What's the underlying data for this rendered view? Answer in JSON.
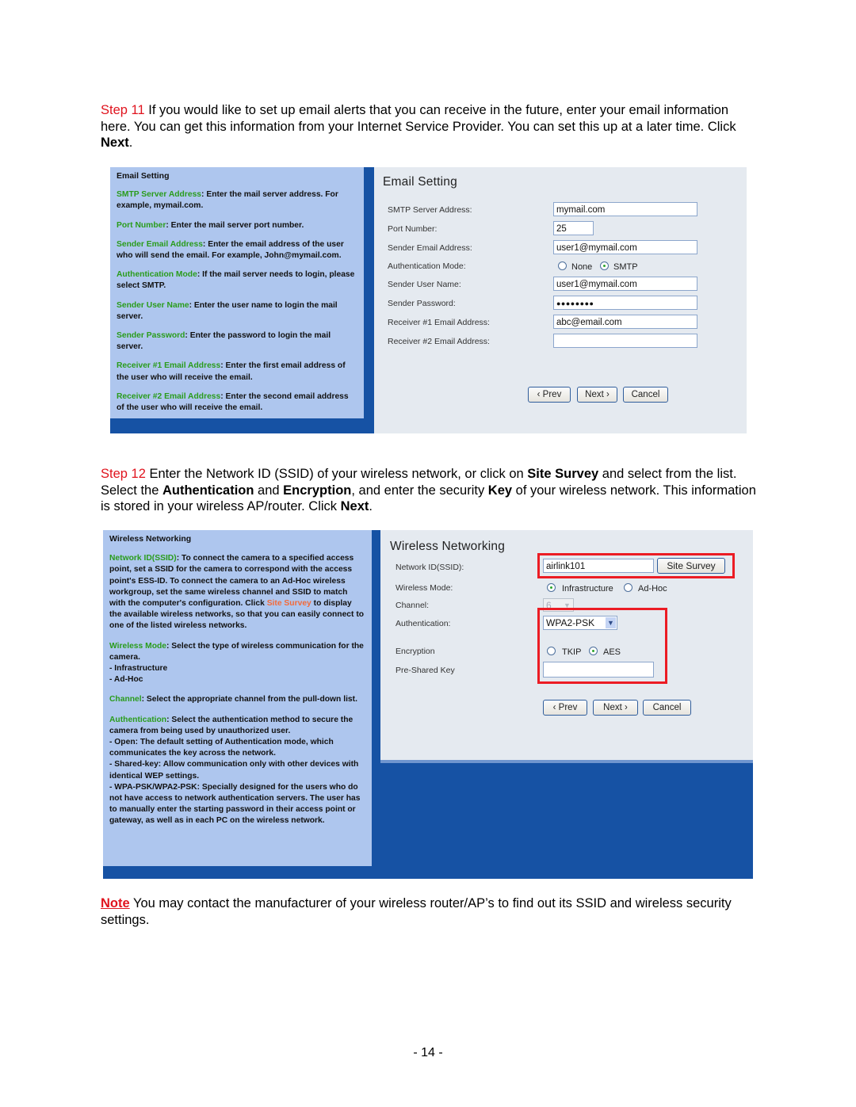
{
  "step11": {
    "label": "Step 11",
    "text_a": " If you would like to set up email alerts that you can receive in the future, enter your email information here.  You can get this information from your Internet Service Provider.  You can set this up at a later time. Click ",
    "bold_next": "Next",
    "end": "."
  },
  "email_help": {
    "title": "Email Setting",
    "items": [
      {
        "term": "SMTP Server Address",
        "desc": ": Enter the mail server address. For example, mymail.com."
      },
      {
        "term": "Port Number",
        "desc": ": Enter the mail server port number."
      },
      {
        "term": "Sender Email Address",
        "desc": ": Enter the email address of the user who will send the email. For example, John@mymail.com."
      },
      {
        "term": "Authentication Mode",
        "desc": ": If the mail server needs to login, please select SMTP."
      },
      {
        "term": "Sender User Name",
        "desc": ": Enter the user name to login the mail server."
      },
      {
        "term": "Sender Password",
        "desc": ": Enter the password to login the mail server."
      },
      {
        "term": "Receiver #1 Email Address",
        "desc": ": Enter the first email address of the user who will receive the email."
      },
      {
        "term": "Receiver #2 Email Address",
        "desc": ": Enter the second email address of the user who will receive the email."
      }
    ]
  },
  "email_form": {
    "title": "Email Setting",
    "labels": {
      "smtp": "SMTP Server Address:",
      "port": "Port Number:",
      "sender_email": "Sender Email Address:",
      "auth_mode": "Authentication Mode:",
      "sender_user": "Sender User Name:",
      "sender_password": "Sender Password:",
      "receiver1": "Receiver #1 Email Address:",
      "receiver2": "Receiver #2 Email Address:"
    },
    "values": {
      "smtp": "mymail.com",
      "port": "25",
      "sender_email": "user1@mymail.com",
      "sender_user": "user1@mymail.com",
      "sender_password": "●●●●●●●●",
      "receiver1": "abc@email.com",
      "receiver2": ""
    },
    "auth_options": [
      "None",
      "SMTP"
    ],
    "auth_selected": "SMTP",
    "buttons": {
      "prev": "‹ Prev",
      "next": "Next ›",
      "cancel": "Cancel"
    }
  },
  "step12": {
    "label": "Step 12",
    "t1": " Enter the Network ID (SSID) of your wireless network, or click on ",
    "b1": "Site Survey",
    "t2": " and select from the list. Select the ",
    "b2": "Authentication",
    "t3": " and ",
    "b3": "Encryption",
    "t4": ", and enter the security ",
    "b4": "Key",
    "t5": " of your wireless network. This information is stored in your wireless AP/router. Click ",
    "b5": "Next",
    "end": "."
  },
  "wireless_help": {
    "title": "Wireless Networking",
    "ssid_term": "Network ID(SSID)",
    "ssid_desc1": ": To connect the camera to a specified access point, set a SSID for the camera to correspond with the access point's ESS-ID. To connect the camera to an Ad-Hoc wireless workgroup, set the same wireless channel and SSID to match with the computer's configuration. Click ",
    "ssid_link": "Site Survey",
    "ssid_desc2": " to display the available wireless networks, so that you can easily connect to one of the listed wireless networks.",
    "mode_term": "Wireless Mode",
    "mode_desc": ": Select the type of wireless communication for the camera.",
    "mode_list": [
      "- Infrastructure",
      "- Ad-Hoc"
    ],
    "channel_term": "Channel",
    "channel_desc": ": Select the appropriate channel from the pull-down list.",
    "auth_term": "Authentication",
    "auth_desc": ": Select the authentication method to secure the camera from being used by unauthorized user.",
    "auth_list": [
      "- Open: The default setting of Authentication mode, which communicates the key across the network.",
      "- Shared-key: Allow communication only with other devices with identical WEP settings.",
      "- WPA-PSK/WPA2-PSK: Specially designed for the users who do not have access to network authentication servers. The user has to manually enter the starting password in their access point or gateway, as well as in each PC on the wireless network."
    ]
  },
  "wireless_form": {
    "title": "Wireless Networking",
    "labels": {
      "ssid": "Network ID(SSID):",
      "mode": "Wireless Mode:",
      "channel": "Channel:",
      "auth": "Authentication:",
      "encryption": "Encryption",
      "psk": "Pre-Shared Key"
    },
    "ssid_value": "airlink101",
    "site_survey": "Site Survey",
    "mode_options": [
      "Infrastructure",
      "Ad-Hoc"
    ],
    "mode_selected": "Infrastructure",
    "channel_value": "6",
    "auth_value": "WPA2-PSK",
    "enc_options": [
      "TKIP",
      "AES"
    ],
    "enc_selected": "AES",
    "psk_value": "",
    "buttons": {
      "prev": "‹ Prev",
      "next": "Next ›",
      "cancel": "Cancel"
    }
  },
  "note": {
    "label": "Note",
    "text": " You may contact the manufacturer of your wireless router/AP’s to find out its SSID and wireless security settings."
  },
  "page_number": "- 14 -"
}
